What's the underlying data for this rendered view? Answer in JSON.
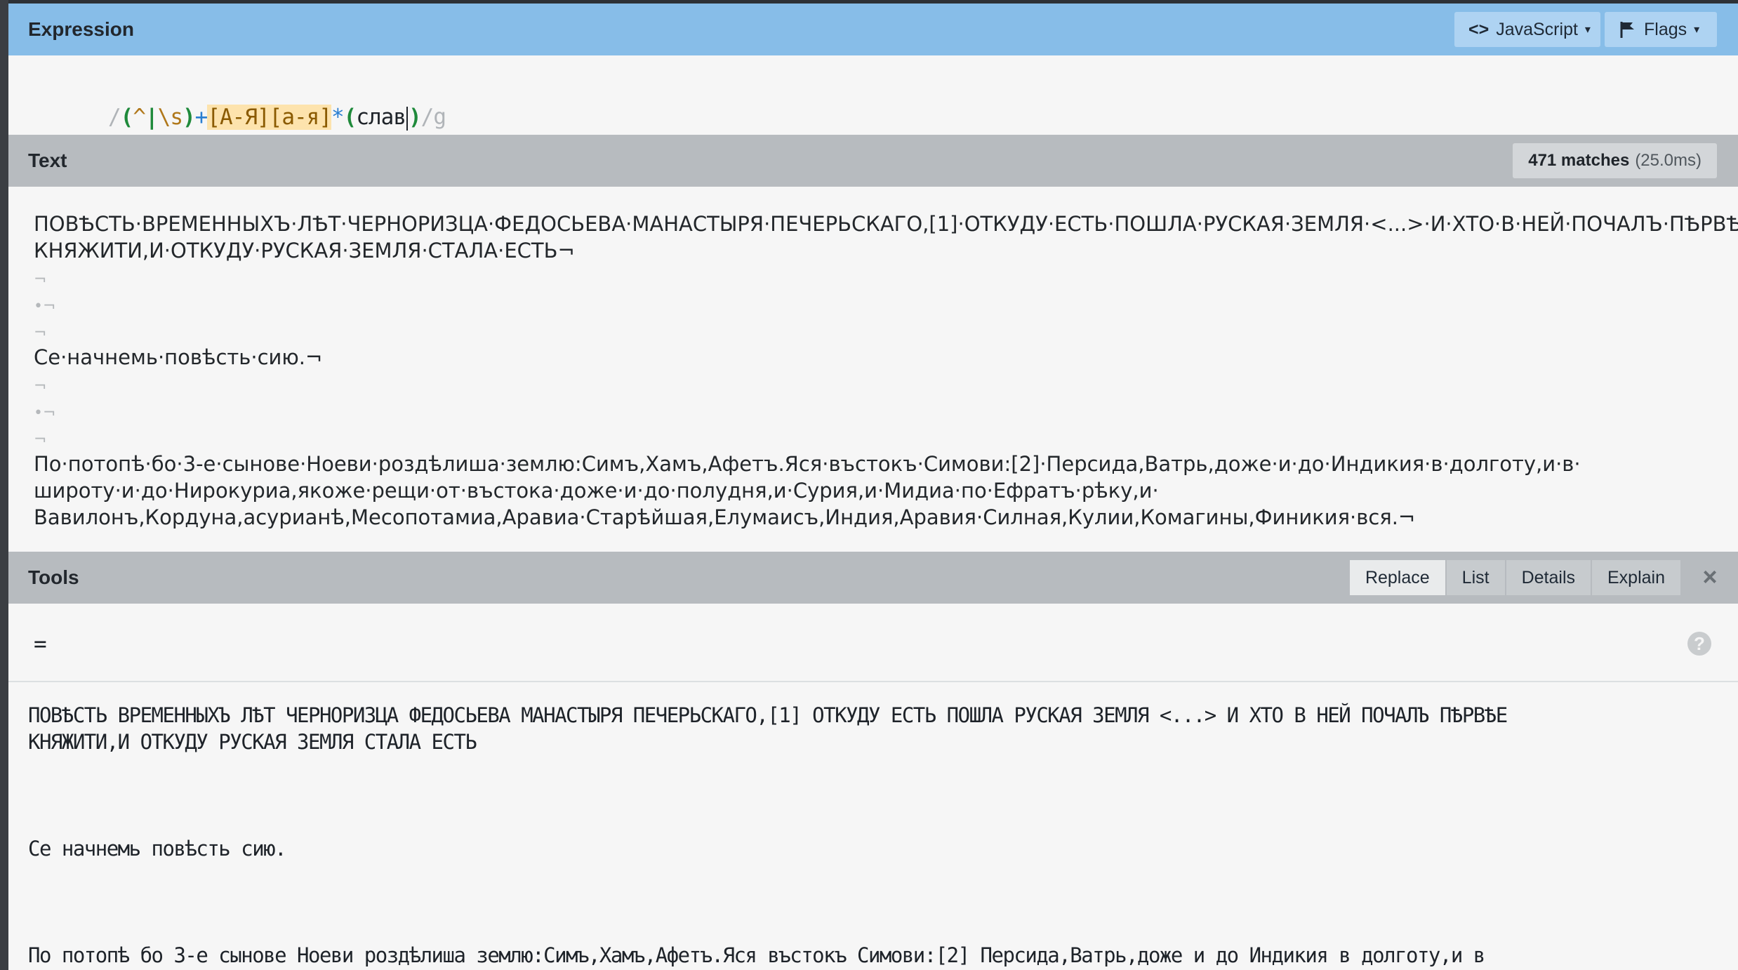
{
  "expression": {
    "header": "Expression",
    "flavor_label": "JavaScript",
    "flags_label": "Flags",
    "pattern_tokens": [
      "/",
      "(",
      "^",
      "|",
      "\\s",
      ")",
      "+",
      "[А-Я]",
      "[а-я]",
      "*",
      "(",
      "слав",
      ")",
      "/g"
    ]
  },
  "text": {
    "header": "Text",
    "matches_count": "471 matches",
    "matches_time": "(25.0ms)",
    "lines": [
      "ПОВѢСТЬ·ВРЕМЕННЫХЪ·ЛѢТ·ЧЕРНОРИЗЦА·ФЕДОСЬЕВА·МАНАСТЫРЯ·ПЕЧЕРЬСКАГО,[1]·ОТКУДУ·ЕСТЬ·ПОШЛА·РУСКАЯ·ЗЕМЛЯ·<...>·И·ХТО·В·НЕЙ·ПОЧАЛЪ·ПѢРВѢЕ·",
      "КНЯЖИТИ,И·ОТКУДУ·РУСКАЯ·ЗЕМЛЯ·СТАЛА·ЕСТЬ¬",
      "¬",
      "•¬",
      "¬",
      "Се·начнемь·повѣсть·сию.¬",
      "¬",
      "•¬",
      "¬",
      "По·потопѣ·бо·3-е·сынове·Ноеви·роздѣлиша·землю:Симъ,Хамъ,Афетъ.Яся·въстокъ·Симови:[2]·Персида,Ватрь,доже·и·до·Индикия·в·долготу,и·в·",
      "широту·и·до·Нирокуриа,якоже·рещи·от·въстока·доже·и·до·полудня,и·Сурия,и·Мидиа·по·Ефратъ·рѣку,и·",
      "Вавилонъ,Кордуна,асурианѣ,Месопотамиа,Аравиа·Старѣйшая,Елумаисъ,Индия,Аравия·Силная,Кулии,Комагины,Финикия·вся.¬"
    ]
  },
  "tools": {
    "header": "Tools",
    "tabs": [
      "Replace",
      "List",
      "Details",
      "Explain"
    ],
    "active_tab": "Replace",
    "replace_value": "=",
    "result_lines": [
      "ПОВѢСТЬ ВРЕМЕННЫХЪ ЛѢТ ЧЕРНОРИЗЦА ФЕДОСЬЕВА МАНАСТЫРЯ ПЕЧЕРЬСКАГО,[1] ОТКУДУ ЕСТЬ ПОШЛА РУСКАЯ ЗЕМЛЯ <...> И ХТО В НЕЙ ПОЧАЛЪ ПѢРВѢЕ",
      "КНЯЖИТИ,И ОТКУДУ РУСКАЯ ЗЕМЛЯ СТАЛА ЕСТЬ",
      "",
      "",
      "",
      "Се начнемь повѣсть сию.",
      "",
      "",
      "",
      "По потопѣ бо 3-е сынове Ноеви роздѣлиша землю:Симъ,Хамъ,Афетъ.Яся въстокъ Симови:[2] Персида,Ватрь,доже и до Индикия в долготу,и в"
    ]
  },
  "icons": {
    "flavor": "code-brackets-icon",
    "flags": "flag-icon",
    "close": "close-icon",
    "help": "help-icon"
  },
  "colors": {
    "expression_header": "#87bde8",
    "section_header": "#b7bbbf",
    "class_highlight": "#fde3ad",
    "group_color": "#1f8a3b"
  }
}
